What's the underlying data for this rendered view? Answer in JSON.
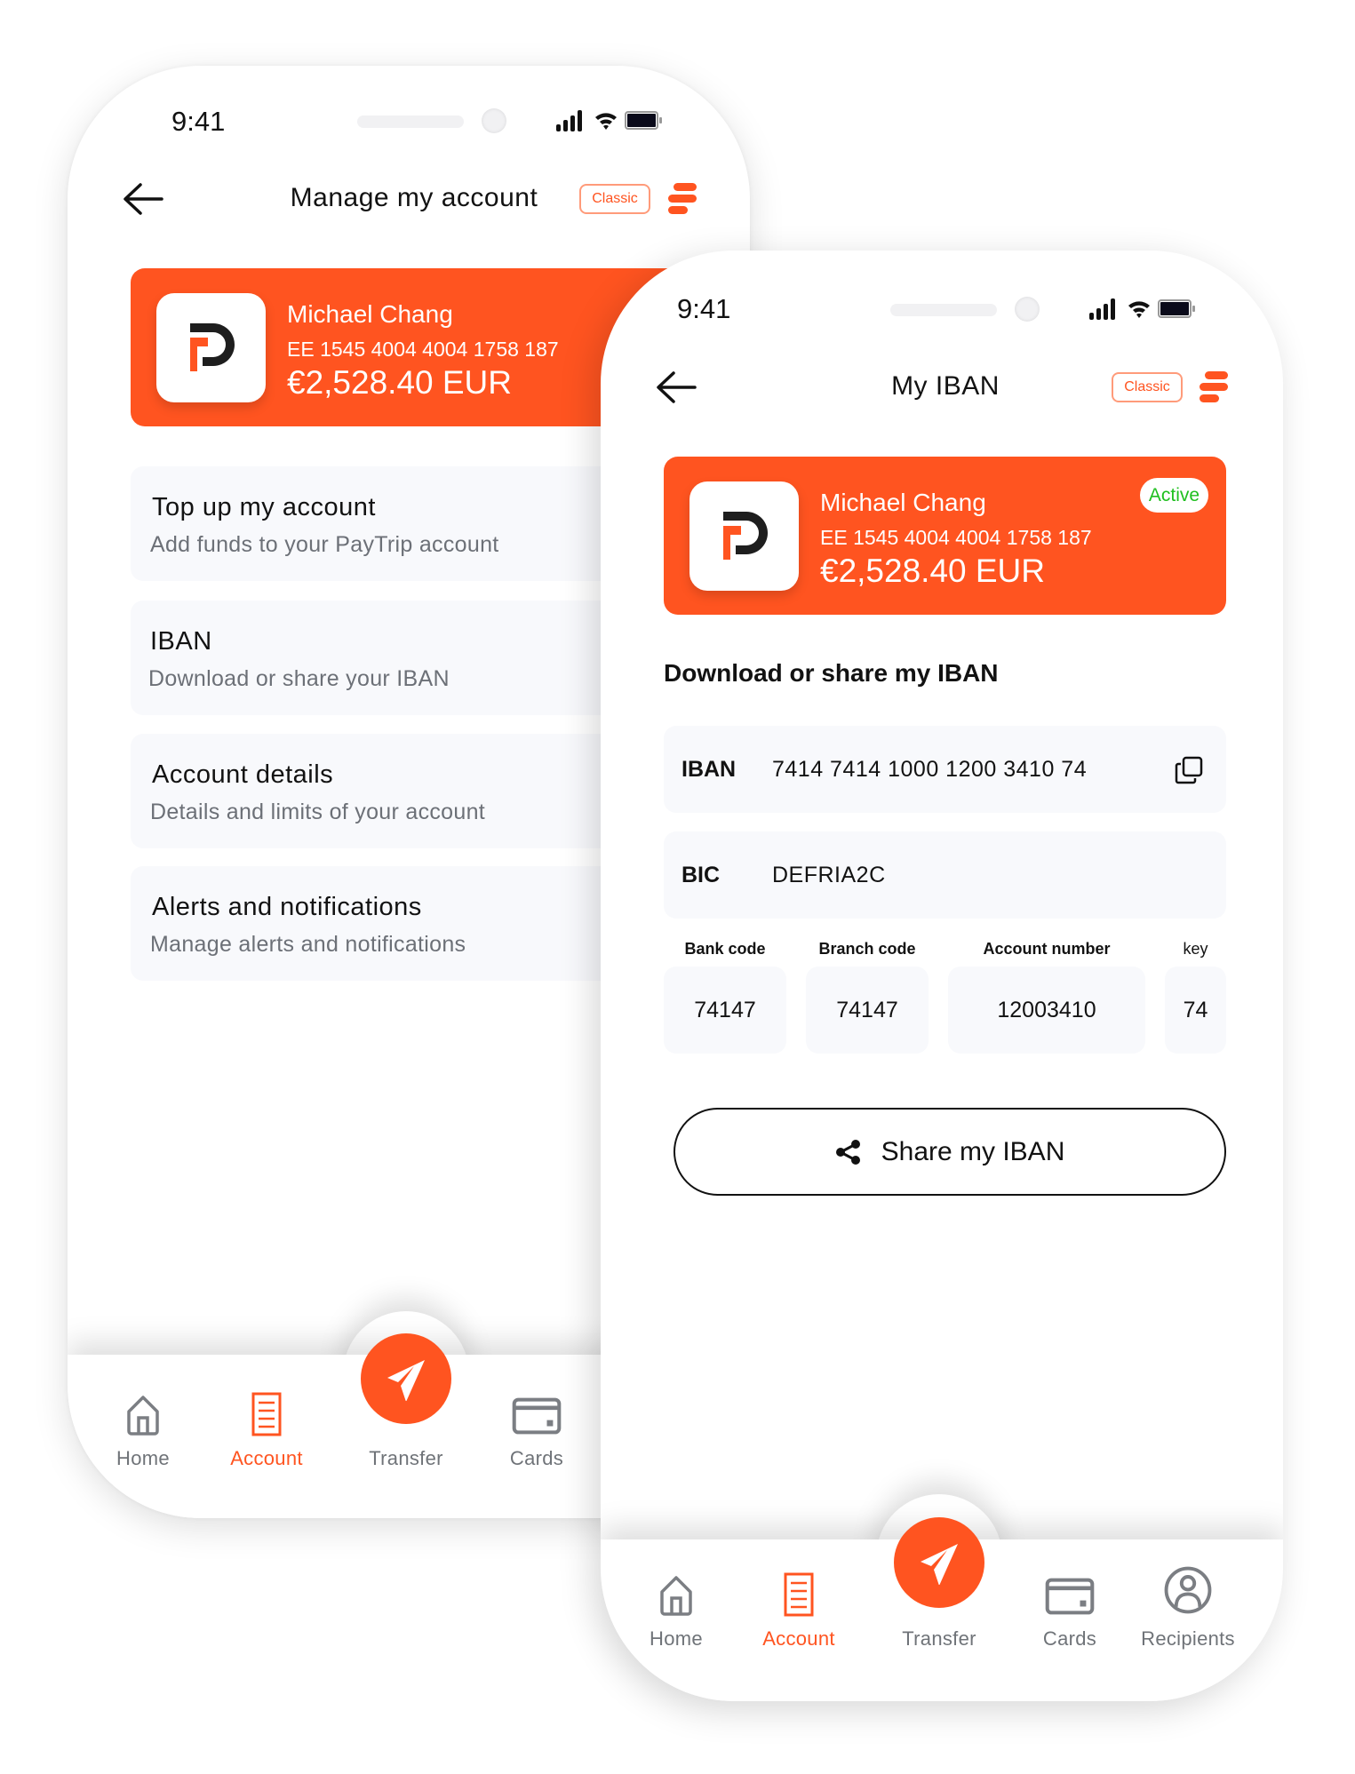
{
  "colors": {
    "accent": "#FF5420",
    "active": "#1FBF1F",
    "text": "#121212",
    "muted": "#6C7077",
    "field_bg": "#F8F9FC"
  },
  "left_phone": {
    "status": {
      "time": "9:41"
    },
    "header": {
      "title": "Manage my account",
      "badge": "Classic"
    },
    "card": {
      "name": "Michael Chang",
      "number": "EE 1545 4004 4004 1758 187",
      "balance": "€2,528.40 EUR"
    },
    "items": [
      {
        "title": "Top up my account",
        "subtitle": "Add funds to your PayTrip account"
      },
      {
        "title": "IBAN",
        "subtitle": "Download or share your IBAN"
      },
      {
        "title": "Account details",
        "subtitle": "Details and limits of your account"
      },
      {
        "title": "Alerts and notifications",
        "subtitle": "Manage alerts and notifications"
      }
    ],
    "nav": [
      {
        "label": "Home",
        "icon": "home-icon"
      },
      {
        "label": "Account",
        "icon": "document-icon",
        "active": true
      },
      {
        "label": "Transfer",
        "icon": "paper-plane-icon"
      },
      {
        "label": "Cards",
        "icon": "card-icon"
      }
    ]
  },
  "right_phone": {
    "status": {
      "time": "9:41"
    },
    "header": {
      "title": "My IBAN",
      "badge": "Classic"
    },
    "card": {
      "name": "Michael Chang",
      "number": "EE 1545 4004 4004 1758 187",
      "balance": "€2,528.40 EUR",
      "status": "Active"
    },
    "section_title": "Download or share my IBAN",
    "iban": {
      "label": "IBAN",
      "value": "7414 7414 1000 1200 3410 74"
    },
    "bic": {
      "label": "BIC",
      "value": "DEFRIA2C"
    },
    "fields": [
      {
        "label": "Bank code",
        "value": "74147"
      },
      {
        "label": "Branch code",
        "value": "74147"
      },
      {
        "label": "Account number",
        "value": "12003410"
      },
      {
        "label": "key",
        "value": "74"
      }
    ],
    "share_label": "Share my IBAN",
    "nav": [
      {
        "label": "Home",
        "icon": "home-icon"
      },
      {
        "label": "Account",
        "icon": "document-icon",
        "active": true
      },
      {
        "label": "Transfer",
        "icon": "paper-plane-icon"
      },
      {
        "label": "Cards",
        "icon": "card-icon"
      },
      {
        "label": "Recipients",
        "icon": "user-circle-icon"
      }
    ]
  }
}
